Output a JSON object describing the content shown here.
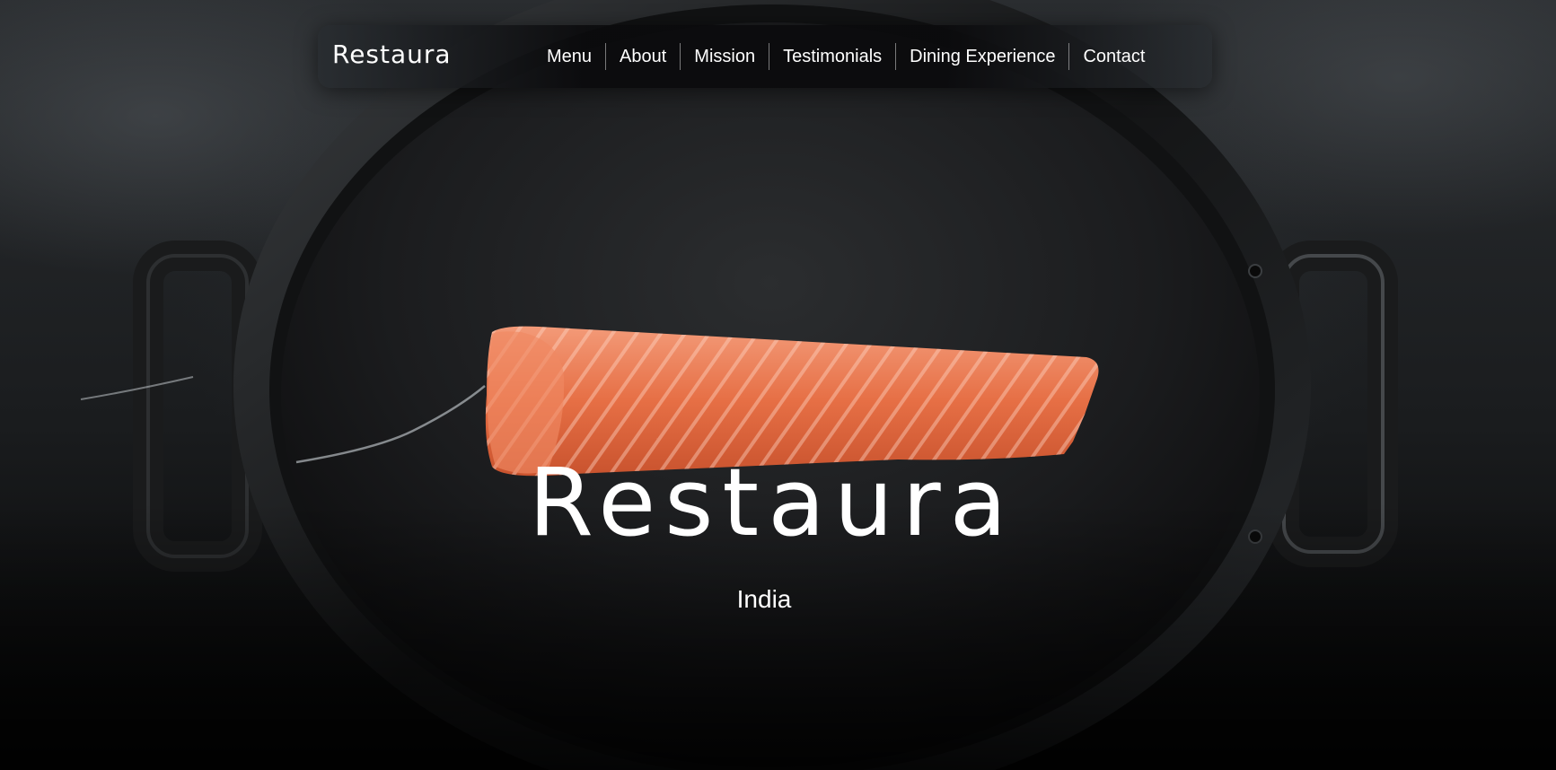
{
  "brand": {
    "logo_text": "Restaura"
  },
  "nav": {
    "items": [
      {
        "label": "Menu"
      },
      {
        "label": "About"
      },
      {
        "label": "Mission"
      },
      {
        "label": "Testimonials"
      },
      {
        "label": "Dining Experience"
      },
      {
        "label": "Contact"
      }
    ]
  },
  "hero": {
    "title": "Restaura",
    "subtitle": "India",
    "background_image": "salmon-fillet-in-black-pan"
  },
  "colors": {
    "text": "#ffffff",
    "background": "#0b0c0d",
    "salmon": "#e8704a",
    "pan": "#1e2022"
  }
}
